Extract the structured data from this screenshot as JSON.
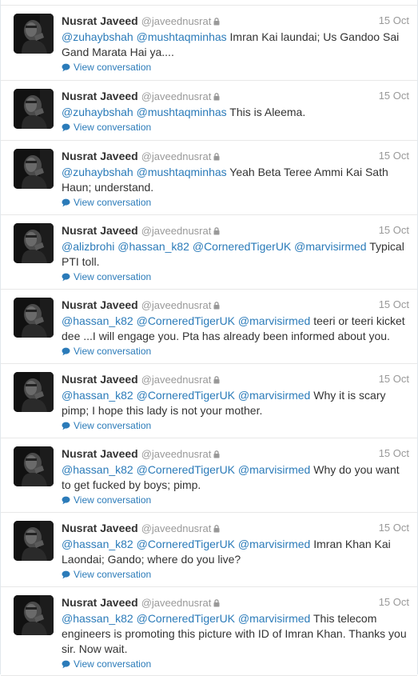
{
  "author": {
    "name": "Nusrat Javeed",
    "handle": "@javeednusrat"
  },
  "colors": {
    "link": "#2b7bb9",
    "meta": "#999999",
    "text": "#333333",
    "divider": "#e8e8e8"
  },
  "icons": {
    "protected": "lock-icon",
    "conversation": "speech-bubble-icon",
    "avatar": "profile-photo"
  },
  "view_conversation_label": "View conversation",
  "tweets": [
    {
      "date": "15 Oct",
      "mentions": [
        "@zuhaybshah",
        "@mushtaqminhas"
      ],
      "text": "Imran Kai laundai; Us Gandoo Sai Gand Marata Hai ya...."
    },
    {
      "date": "15 Oct",
      "mentions": [
        "@zuhaybshah",
        "@mushtaqminhas"
      ],
      "text": "This is Aleema."
    },
    {
      "date": "15 Oct",
      "mentions": [
        "@zuhaybshah",
        "@mushtaqminhas"
      ],
      "text": "Yeah Beta Teree Ammi Kai Sath Haun; understand."
    },
    {
      "date": "15 Oct",
      "mentions": [
        "@alizbrohi",
        "@hassan_k82",
        "@CorneredTigerUK",
        "@marvisirmed"
      ],
      "text": "Typical PTI toll."
    },
    {
      "date": "15 Oct",
      "mentions": [
        "@hassan_k82",
        "@CorneredTigerUK",
        "@marvisirmed"
      ],
      "text": "teeri or teeri kicket dee ...I will engage you. Pta has already been informed about you."
    },
    {
      "date": "15 Oct",
      "mentions": [
        "@hassan_k82",
        "@CorneredTigerUK",
        "@marvisirmed"
      ],
      "text": "Why it is scary pimp; I hope this lady is not your mother."
    },
    {
      "date": "15 Oct",
      "mentions": [
        "@hassan_k82",
        "@CorneredTigerUK",
        "@marvisirmed"
      ],
      "text": "Why do you want to get fucked by boys; pimp."
    },
    {
      "date": "15 Oct",
      "mentions": [
        "@hassan_k82",
        "@CorneredTigerUK",
        "@marvisirmed"
      ],
      "text": "Imran Khan Kai Laondai; Gando; where do you live?"
    },
    {
      "date": "15 Oct",
      "mentions": [
        "@hassan_k82",
        "@CorneredTigerUK",
        "@marvisirmed"
      ],
      "text": "This telecom engineers is promoting this picture with ID of Imran Khan. Thanks you sir. Now wait."
    }
  ]
}
